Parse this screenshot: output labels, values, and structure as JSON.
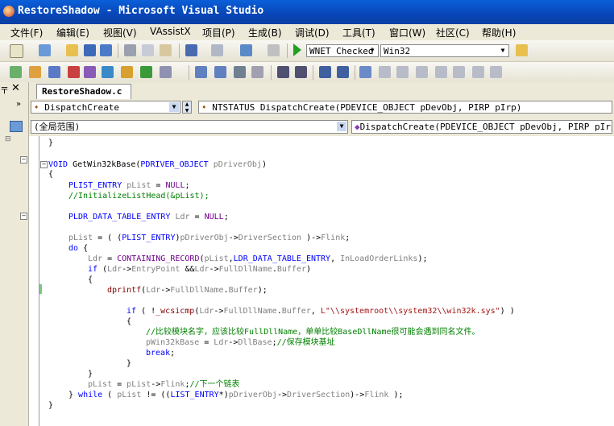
{
  "window": {
    "title": "RestoreShadow - Microsoft Visual Studio"
  },
  "menu": [
    "文件(F)",
    "编辑(E)",
    "视图(V)",
    "VAssistX",
    "项目(P)",
    "生成(B)",
    "调试(D)",
    "工具(T)",
    "窗口(W)",
    "社区(C)",
    "帮助(H)"
  ],
  "toolbar": {
    "config": "WNET Checked",
    "platform": "Win32"
  },
  "tab": {
    "filename": "RestoreShadow.c"
  },
  "nav": {
    "function_list": "DispatchCreate",
    "signature": "NTSTATUS DispatchCreate(PDEVICE_OBJECT pDevObj, PIRP pIrp)",
    "scope": "(全局范围)",
    "member": "DispatchCreate(PDEVICE_OBJECT pDevObj, PIRP pIrp)"
  },
  "code": {
    "l0": "}",
    "l1": "VOID GetWin32kBase(PDRIVER_OBJECT pDriverObj)",
    "l2": "{",
    "l3": "PLIST_ENTRY pList = NULL;",
    "l4": "//InitializeListHead(&pList);",
    "l5": "PLDR_DATA_TABLE_ENTRY Ldr = NULL;",
    "l6": "pList = ( (PLIST_ENTRY)pDriverObj->DriverSection )->Flink;",
    "l7": "do {",
    "l8": "Ldr = CONTAINING_RECORD(pList,LDR_DATA_TABLE_ENTRY, InLoadOrderLinks);",
    "l9": "if (Ldr->EntryPoint &&Ldr->FullDllName.Buffer)",
    "l10": "{",
    "l11": "dprintf(Ldr->FullDllName.Buffer);",
    "l12": "if ( !_wcsicmp(Ldr->FullDllName.Buffer, L\"\\\\systemroot\\\\system32\\\\win32k.sys\") )",
    "l13": "{",
    "l14": "//比较模块名字，应该比较FullDllName，单单比较BaseDllName很可能会遇到同名文件。",
    "l15": "pWin32kBase = Ldr->DllBase;//保存模块基址",
    "l16": "break;",
    "l17": "}",
    "l18": "}",
    "l19": "pList = pList->Flink;//下一个链表",
    "l20": "} while ( pList != ((LIST_ENTRY*)pDriverObj->DriverSection)->Flink );",
    "l21": "}"
  }
}
